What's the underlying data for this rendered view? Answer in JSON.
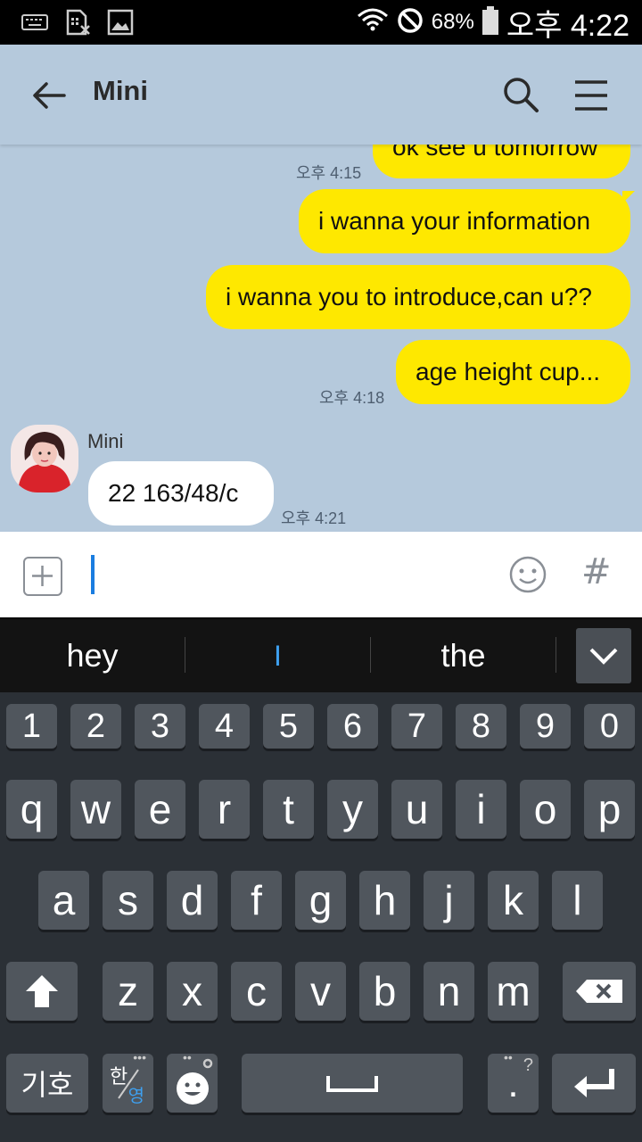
{
  "status_bar": {
    "left_icons": [
      "keyboard-icon",
      "no-sim-icon",
      "image-icon"
    ],
    "right_icons": [
      "wifi-icon",
      "do-not-disturb-icon",
      "battery-icon"
    ],
    "battery": "68%",
    "time": "오후 4:22"
  },
  "header": {
    "title": "Mini",
    "icons": [
      "back-arrow-icon",
      "search-icon",
      "menu-icon"
    ]
  },
  "messages": [
    {
      "from": "me",
      "text": "ok see u tomorrow",
      "time": "오후 4:15"
    },
    {
      "from": "me",
      "text": "i wanna your information"
    },
    {
      "from": "me",
      "text": "i wanna you to introduce,can u??"
    },
    {
      "from": "me",
      "text": "age height cup...",
      "time": "오후 4:18"
    },
    {
      "from": "other",
      "sender": "Mini",
      "text": "22 163/48/c",
      "time": "오후 4:21"
    }
  ],
  "input": {
    "value": "",
    "icons": [
      "plus-icon",
      "emoticon-icon",
      "hashtag-icon"
    ],
    "hash_label": "#"
  },
  "suggestions": [
    "hey",
    "I",
    "the"
  ],
  "keyboard": {
    "row_numbers": [
      "1",
      "2",
      "3",
      "4",
      "5",
      "6",
      "7",
      "8",
      "9",
      "0"
    ],
    "row_top": [
      "q",
      "w",
      "e",
      "r",
      "t",
      "y",
      "u",
      "i",
      "o",
      "p"
    ],
    "row_middle": [
      "a",
      "s",
      "d",
      "f",
      "g",
      "h",
      "j",
      "k",
      "l"
    ],
    "row_bottom": [
      "z",
      "x",
      "c",
      "v",
      "b",
      "n",
      "m"
    ],
    "symbols_key": "기호",
    "lang_key_top": "한",
    "lang_key_bottom": "영",
    "period_key": ".",
    "period_hint": "?"
  },
  "colors": {
    "chat_background": "#b5c9dc",
    "my_bubble": "#fee800",
    "their_bubble": "#ffffff",
    "caret": "#1a7de0",
    "keyboard_background": "#2b3036",
    "key": "#50565d"
  }
}
